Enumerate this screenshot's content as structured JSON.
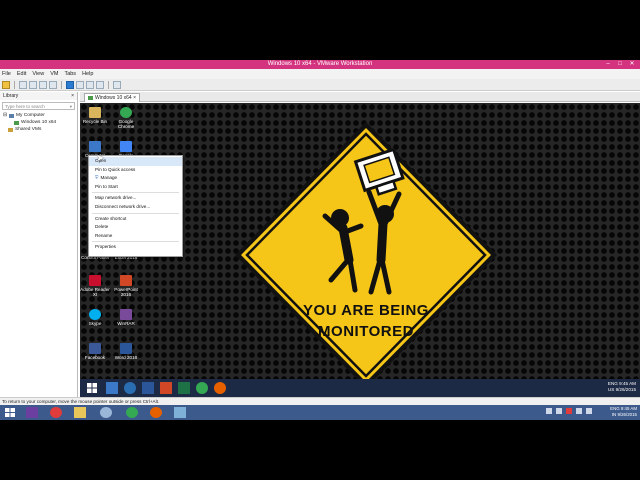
{
  "window": {
    "title": "Windows 10 x64 - VMware Workstation",
    "controls": [
      "–",
      "□",
      "✕"
    ]
  },
  "menu": [
    "File",
    "Edit",
    "View",
    "VM",
    "Tabs",
    "Help"
  ],
  "library": {
    "title": "Library",
    "search_placeholder": "Type here to search",
    "items": [
      "My Computer",
      "Windows 10 x64",
      "Shared VMs"
    ]
  },
  "tab": {
    "label": "Windows 10 x64",
    "close": "×"
  },
  "desktop_icons": [
    {
      "label": "Recycle Bin",
      "color": "#d8b45c"
    },
    {
      "label": "Google Chrome",
      "color": "#34a853"
    },
    {
      "label": "Computer",
      "color": "#3c78c8"
    },
    {
      "label": "Google",
      "color": "#4285f4"
    },
    {
      "label": "Control Panel",
      "color": "#5a7fa8"
    },
    {
      "label": "Excel 2016",
      "color": "#1e7145"
    },
    {
      "label": "Adobe Reader XI",
      "color": "#c8102e"
    },
    {
      "label": "PowerPoint 2016",
      "color": "#d24726"
    },
    {
      "label": "Skype",
      "color": "#00aff0"
    },
    {
      "label": "WinRAR",
      "color": "#7a4a9a"
    },
    {
      "label": "Facebook",
      "color": "#3b5998"
    },
    {
      "label": "Word 2016",
      "color": "#2b579a"
    }
  ],
  "context_menu": [
    "Open",
    "Pin to Quick access",
    "Manage",
    "Pin to Start",
    "Map network drive...",
    "Disconnect network drive...",
    "Create shortcut",
    "Delete",
    "Rename",
    "Properties"
  ],
  "sign": {
    "line1": "YOU ARE BEING",
    "line2": "MONITORED",
    "color": "#f5c518"
  },
  "guest_tray": {
    "lang": "ENG",
    "region": "US",
    "time": "9:45 AM",
    "date": "9/26/2015"
  },
  "status_text": "To return to your computer, move the mouse pointer outside or press Ctrl+Alt.",
  "host_tray": {
    "lang": "ENG",
    "region": "IN",
    "time": "9:45 AM",
    "date": "9/26/2015"
  }
}
